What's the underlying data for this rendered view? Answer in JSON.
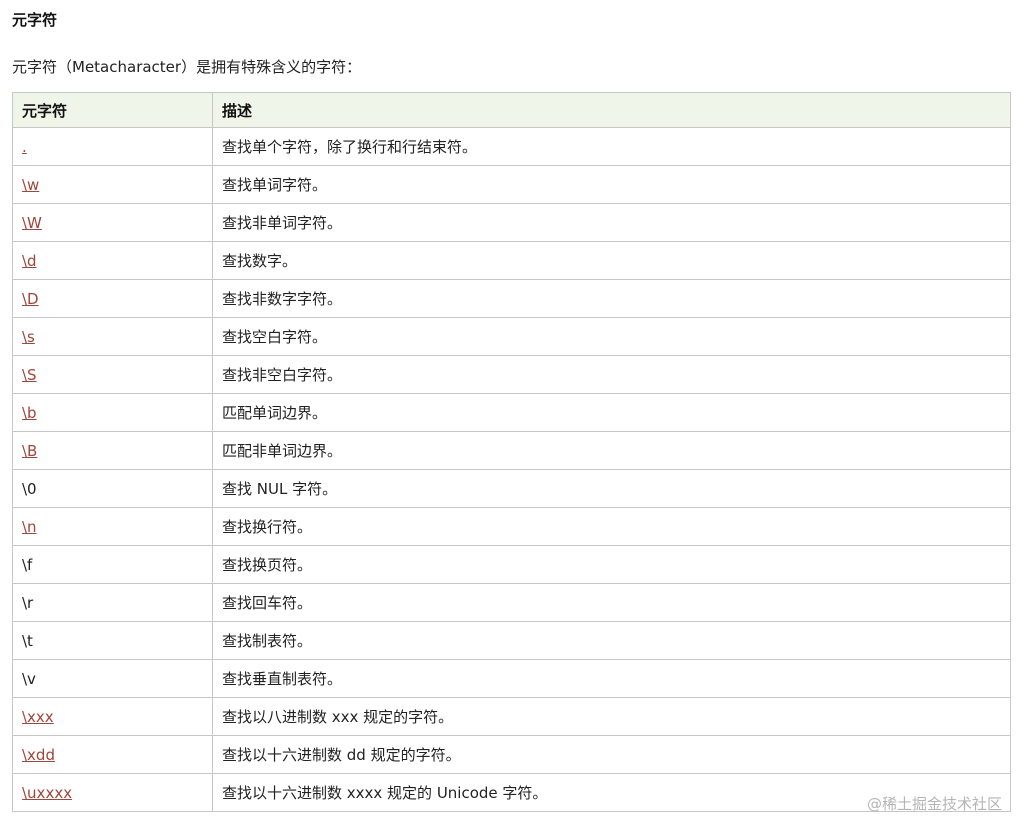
{
  "section": {
    "title": "元字符",
    "intro": "元字符（Metacharacter）是拥有特殊含义的字符："
  },
  "table": {
    "headers": [
      "元字符",
      "描述"
    ],
    "rows": [
      {
        "char": ".",
        "desc": "查找单个字符，除了换行和行结束符。",
        "link": true
      },
      {
        "char": "\\w",
        "desc": "查找单词字符。",
        "link": true
      },
      {
        "char": "\\W",
        "desc": "查找非单词字符。",
        "link": true
      },
      {
        "char": "\\d",
        "desc": "查找数字。",
        "link": true
      },
      {
        "char": "\\D",
        "desc": "查找非数字字符。",
        "link": true
      },
      {
        "char": "\\s",
        "desc": "查找空白字符。",
        "link": true
      },
      {
        "char": "\\S",
        "desc": "查找非空白字符。",
        "link": true
      },
      {
        "char": "\\b",
        "desc": "匹配单词边界。",
        "link": true
      },
      {
        "char": "\\B",
        "desc": "匹配非单词边界。",
        "link": true
      },
      {
        "char": "\\0",
        "desc": "查找 NUL 字符。",
        "link": false
      },
      {
        "char": "\\n",
        "desc": "查找换行符。",
        "link": true
      },
      {
        "char": "\\f",
        "desc": "查找换页符。",
        "link": false
      },
      {
        "char": "\\r",
        "desc": "查找回车符。",
        "link": false
      },
      {
        "char": "\\t",
        "desc": "查找制表符。",
        "link": false
      },
      {
        "char": "\\v",
        "desc": "查找垂直制表符。",
        "link": false
      },
      {
        "char": "\\xxx",
        "desc": "查找以八进制数 xxx 规定的字符。",
        "link": true
      },
      {
        "char": "\\xdd",
        "desc": "查找以十六进制数 dd 规定的字符。",
        "link": true
      },
      {
        "char": "\\uxxxx",
        "desc": "查找以十六进制数 xxxx 规定的 Unicode 字符。",
        "link": true
      }
    ]
  },
  "watermark": "@稀土掘金技术社区",
  "colors": {
    "link": "#a0453a",
    "header_bg": "#f0f5ea",
    "border": "#c7c7c7"
  }
}
